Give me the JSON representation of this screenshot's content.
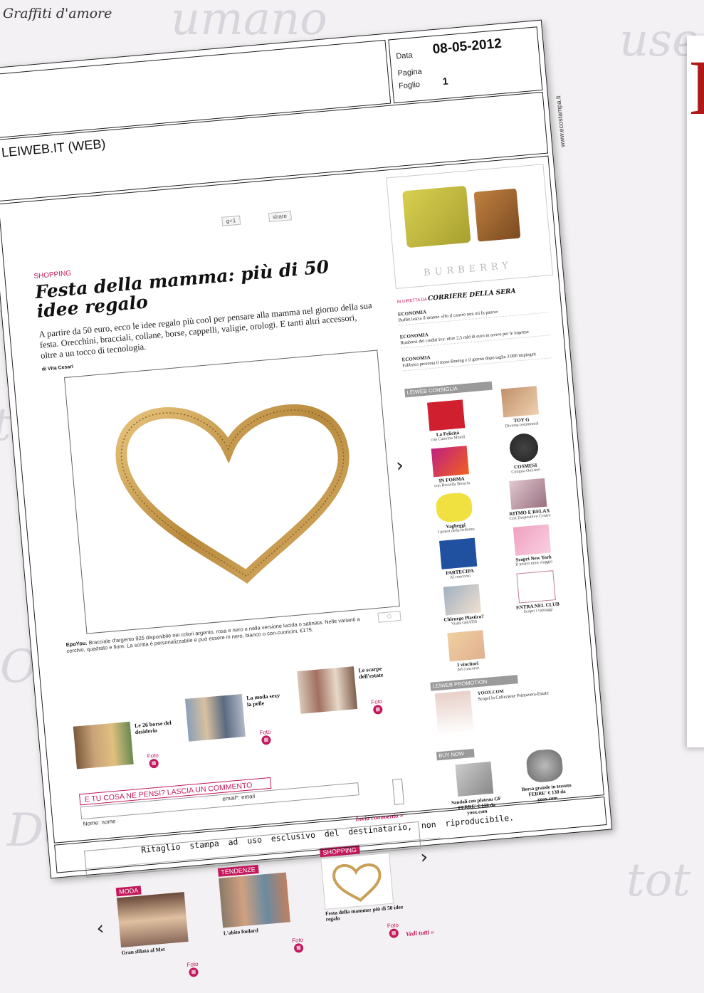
{
  "header": {
    "brand": "Graffiti d'amore"
  },
  "meta": {
    "data_label": "Data",
    "data_value": "08-05-2012",
    "pagina_label": "Pagina",
    "pagina_value": "",
    "foglio_label": "Foglio",
    "foglio_value": "1"
  },
  "source": {
    "name": "LEIWEB.IT (WEB)",
    "side_text": "www.ecostampa.it"
  },
  "article": {
    "kicker": "SHOPPING",
    "title": "Festa della mamma: più di 50 idee regalo",
    "lead": "A partire da 50 euro, ecco le idee regalo più cool per pensare alla mamma nel giorno della sua festa. Orecchini, bracciali, collane, borse, cappelli, valigie, orologi. E tanti altri accessori, oltre a un tocco di tecnologia.",
    "byline_author": "di Vita Cesari",
    "caption_title": "EpoYou.",
    "caption": "Bracciale d'argento 925 disponibile nei colori argento, rosa e nero e nella versione lucida o satinata. Nelle varianti a cerchio, quadrato e fiore. La scritta è personalizzabile e può essere in nero, bianco o con-cuoricini, €175.",
    "thumbs": [
      {
        "label": "Le 26 borse del desiderio",
        "foto": "Foto"
      },
      {
        "label": "La moda sexy la pelle",
        "foto": "Foto"
      },
      {
        "label": "Le scarpe dell'estate",
        "foto": "Foto"
      }
    ]
  },
  "comment": {
    "heading": "E TU COSA NE PENSI? LASCIA UN COMMENTO",
    "name_label": "Nome: nome",
    "email_label": "email*: email",
    "send": "Invia commento »"
  },
  "carousel": {
    "items": [
      {
        "tag": "MODA",
        "label": "Gran sfilata al Met",
        "foto": "Foto"
      },
      {
        "tag": "TENDENZE",
        "label": "L'abito foulard",
        "foto": "Foto"
      },
      {
        "tag": "SHOPPING",
        "label": "Festa della mamma: più di 50 idee regalo",
        "foto": "Foto"
      }
    ],
    "more": "Vedi tutti »"
  },
  "sidebar": {
    "ad_logo": "BURBERRY",
    "corriere_prefix": "IN DIRETTA DA",
    "corriere_name": "CORRIERE DELLA SERA",
    "news": [
      {
        "cat": "ECONOMIA",
        "text": "Buffet lascia il timone «Ho il cancro non mi fa paura»"
      },
      {
        "cat": "ECONOMIA",
        "text": "Rimborsi dei crediti Iva: oltre 2,5 mld di euro in arrivo per le imprese"
      },
      {
        "cat": "ECONOMIA",
        "text": "Fabbrica presenta il maxi-Boeing e il giorno dopo taglia 3.000 impiegati"
      }
    ],
    "consiglia_header": "LEIWEB CONSIGLIA",
    "consiglia": [
      {
        "title": "La Felicità",
        "sub": "con Caterina Minoli"
      },
      {
        "title": "TOY G",
        "sub": "Diventa testimonial"
      },
      {
        "title": "IN FORMA",
        "sub": "con Rossella Brescia"
      },
      {
        "title": "COSMESI",
        "sub": "Compra OnLine!"
      },
      {
        "title": "Vagheggi",
        "sub": "I poteri della bellezza"
      },
      {
        "title": "RITMO E RELAX",
        "sub": "Con Despositivo Centro"
      },
      {
        "title": "PARTECIPA",
        "sub": "Al concorso"
      },
      {
        "title": "Scopri New York",
        "sub": "Il nostro mini viaggio"
      },
      {
        "title": "Chirurgo Plastico?",
        "sub": "Visita GRATIS"
      },
      {
        "title": "ENTRA NEL CLUB",
        "sub": "Scopri i vantaggi"
      },
      {
        "title": "I vincitori",
        "sub": "del concorso"
      }
    ],
    "promotion_header": "LEIWEB PROMOTION",
    "promotion_title": "YOOX.COM",
    "promotion_text": "Scopri la Collezione Primavera-Estate",
    "buy_header": "BUY NOW",
    "buy": [
      {
        "text": "Sandali con plateau GF FERRE' € 158 da yoox.com"
      },
      {
        "text": "Borsa grande in tessuto FERRE' € 138 da yoox.com"
      }
    ]
  },
  "footer": {
    "text": "Ritaglio stampa ad uso esclusivo del destinatario, non riproducibile."
  },
  "colors": {
    "accent": "#c2185b",
    "sidebar_header": "#9a9a9a"
  }
}
